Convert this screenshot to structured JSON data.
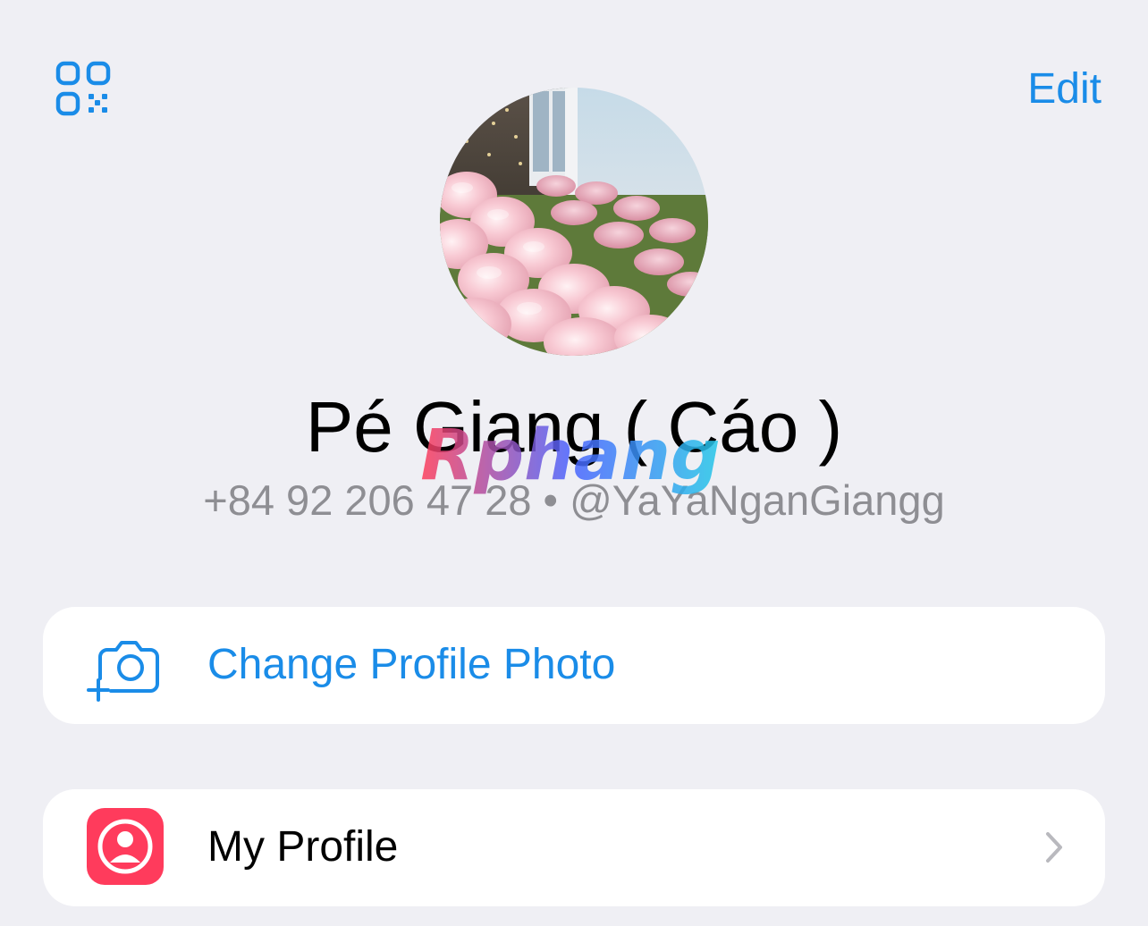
{
  "header": {
    "qr_icon": "qr-code-icon",
    "edit_label": "Edit"
  },
  "profile": {
    "avatar": "tulip-flowers-photo",
    "name": "Pé Giang ( Cáo )",
    "phone": "+84 92 206 47 28",
    "separator": "•",
    "username": "@YaYaNganGiangg"
  },
  "actions": {
    "change_photo": {
      "label": "Change Profile Photo",
      "icon": "camera-add-icon"
    },
    "my_profile": {
      "label": "My Profile",
      "icon": "person-circle-icon",
      "chevron": "chevron-right-icon"
    }
  },
  "watermark": {
    "text": "Rphang"
  },
  "colors": {
    "accent": "#1a8ce8",
    "background": "#efeff4",
    "card": "#ffffff",
    "secondary_text": "#8e8e93",
    "profile_icon_bg": "#ff3b5c"
  }
}
